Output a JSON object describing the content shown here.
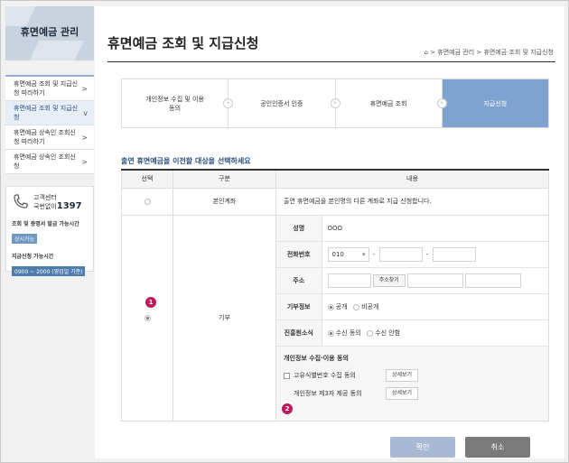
{
  "sidebar": {
    "title": "휴면예금 관리",
    "items": [
      {
        "label": "휴면예금 조회 및 지급신청 따라하기",
        "active": false
      },
      {
        "label": "휴면예금 조회 및 지급신청",
        "active": true
      },
      {
        "label": "휴면예금 상속인 조회신청 따라하기",
        "active": false
      },
      {
        "label": "휴면예금 상속인 조회신청",
        "active": false
      }
    ],
    "customer_center": {
      "label": "고객센터",
      "line2": "국번없이",
      "number": "1397"
    },
    "docs_label": "조회 및 증명서 발급 가능시간",
    "docs_badge": "상시가능",
    "payout_label": "지급신청 가능시간",
    "payout_badge": "0900 ~ 2000 (영업일 기준)"
  },
  "header": {
    "title": "휴면예금 조회 및 지급신청",
    "breadcrumb": [
      "휴면예금 관리",
      "휴면예금 조회 및 지급신청"
    ]
  },
  "steps": [
    {
      "label": "개인정보 수집 및 이용동의",
      "active": false
    },
    {
      "label": "공인인증서 인증",
      "active": false
    },
    {
      "label": "휴면예금 조회",
      "active": false
    },
    {
      "label": "지급신청",
      "active": true
    }
  ],
  "section_title": "출연 휴면예금을 이전할 대상을 선택하세요",
  "table": {
    "headers": [
      "선택",
      "구분",
      "내용"
    ],
    "row1": {
      "type": "본인계좌",
      "content": "출연 휴면예금을 본인명의 다른 계좌로 지급 신청합니다."
    },
    "row2": {
      "type": "기부",
      "name_label": "성명",
      "name_value": "OOO",
      "phone_label": "전화번호",
      "phone_prefix": "010",
      "address_label": "주소",
      "address_button": "주소찾기",
      "donation_label": "기부정보",
      "donation_opt1": "공개",
      "donation_opt2": "비공개",
      "promo_label": "진흥원소식",
      "promo_opt1": "수신 동의",
      "promo_opt2": "수신 안함",
      "consent_title": "개인정보 수집·이용 동의",
      "consent1": "고유식별번호 수집 동의",
      "consent2": "개인정보 제3자 제공 동의",
      "detail_button": "상세보기"
    }
  },
  "markers": [
    "1",
    "2"
  ],
  "buttons": {
    "confirm": "확인",
    "cancel": "취소"
  },
  "colors": {
    "accent": "#7ea3cf",
    "marker": "#c01a5b",
    "cancel": "#7a7a7a",
    "confirm": "#a7b9d3"
  }
}
